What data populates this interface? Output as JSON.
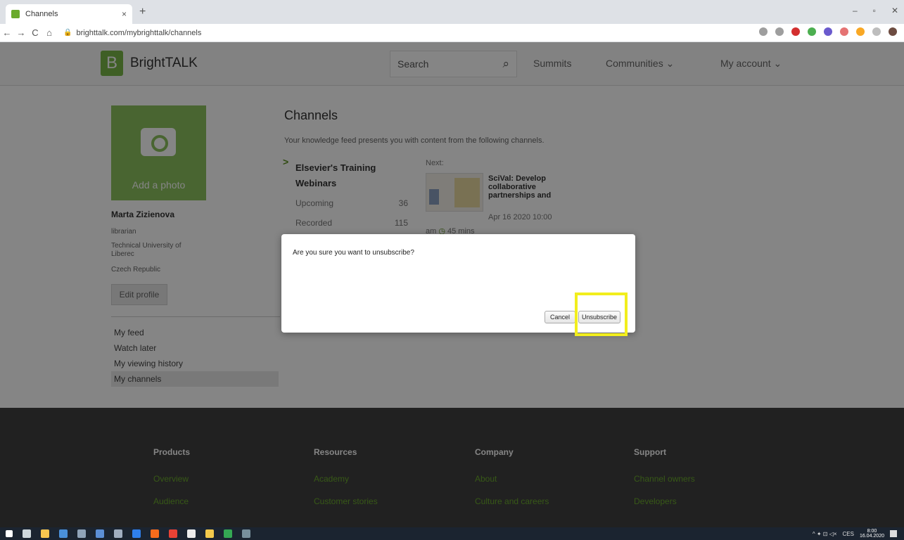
{
  "browser": {
    "tab_title": "Channels",
    "tab_close": "×",
    "new_tab": "+",
    "url": "brighttalk.com/mybrighttalk/channels",
    "nav": {
      "back": "←",
      "forward": "→",
      "reload": "C",
      "home": "⌂"
    },
    "window_controls": {
      "minimize": "–",
      "maximize": "▫",
      "close": "✕"
    },
    "extension_colors": [
      "#d32f2f",
      "#4caf50",
      "#6a5acd",
      "#e57373",
      "#f9a825",
      "#bdbdbd",
      "#6d4c41"
    ]
  },
  "header": {
    "logo_letter": "B",
    "brand": "BrightTALK",
    "search_placeholder": "Search",
    "search_icon": "⌕",
    "nav": [
      "Summits",
      "Communities ⌄",
      "My account ⌄"
    ]
  },
  "profile": {
    "photo_label": "Add a photo",
    "name": "Marta Zizienova",
    "role": "librarian",
    "org_line1": "Technical University of",
    "org_line2": "Liberec",
    "country": "Czech Republic",
    "edit_label": "Edit profile",
    "sidebar": [
      "My feed",
      "Watch later",
      "My viewing history",
      "My channels"
    ],
    "active_item": "My channels"
  },
  "channels": {
    "title": "Channels",
    "description": "Your knowledge feed presents you with content from the following channels.",
    "chevron": ">",
    "channel_name_line1": "Elsevier's Training",
    "channel_name_line2": "Webinars",
    "upcoming_label": "Upcoming",
    "upcoming_count": "36",
    "recorded_label": "Recorded",
    "recorded_count": "115",
    "next_label": "Next:",
    "webinar_title": "SciVal: Develop collaborative partnerships and",
    "webinar_date": "Apr 16 2020 10:00",
    "webinar_am": "am",
    "webinar_clock": "◷",
    "webinar_duration": "45 mins"
  },
  "dialog": {
    "question": "Are you sure you want to unsubscribe?",
    "cancel_label": "Cancel",
    "unsubscribe_label": "Unsubscribe",
    "highlight_color": "#f2ee1d"
  },
  "footer": {
    "columns": [
      {
        "heading": "Products",
        "link": "Overview",
        "link2": "Audience"
      },
      {
        "heading": "Resources",
        "link": "Academy",
        "link2": "Customer stories"
      },
      {
        "heading": "Company",
        "link": "About",
        "link2": "Culture and careers"
      },
      {
        "heading": "Support",
        "link": "Channel owners",
        "link2": "Developers"
      }
    ],
    "link_color": "#6aaa2c"
  },
  "taskbar": {
    "language": "CES",
    "time": "8:00",
    "date": "16.04.2020",
    "tray_icons": "^ ✦ ⊡ ◁×"
  }
}
